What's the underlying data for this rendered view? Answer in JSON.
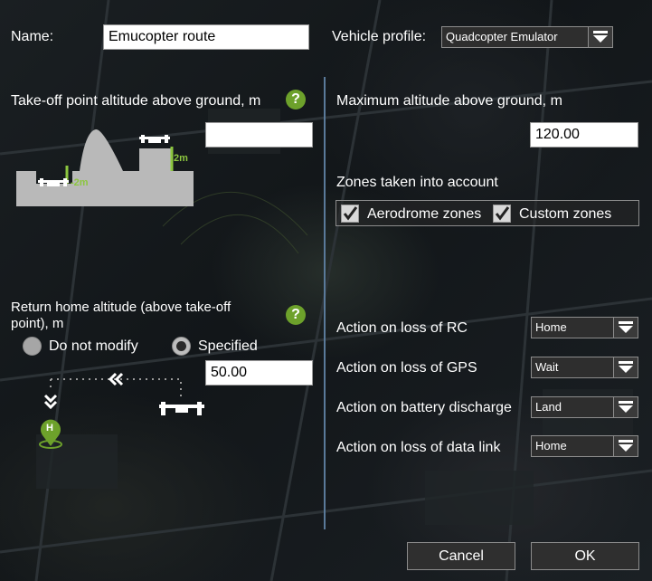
{
  "header": {
    "name_label": "Name:",
    "name_value": "Emucopter route",
    "vehicle_profile_label": "Vehicle profile:",
    "vehicle_profile_value": "Quadcopter Emulator"
  },
  "left": {
    "takeoff_label": "Take-off point altitude above ground, m",
    "takeoff_value": "",
    "takeoff_help": "?",
    "diagram_labels": {
      "right_height": "2m",
      "left_height": "-2m"
    },
    "return_label_line1": "Return home altitude (above take-off",
    "return_label_line2": "point), m",
    "return_help": "?",
    "radio_do_not_modify": "Do not modify",
    "radio_specified": "Specified",
    "return_value": "50.00",
    "home_marker_letter": "H"
  },
  "right": {
    "max_alt_label": "Maximum altitude above ground, m",
    "max_alt_value": "120.00",
    "zones_label": "Zones taken into account",
    "zone_aerodrome": "Aerodrome zones",
    "zone_custom": "Custom zones",
    "failsafe": [
      {
        "label": "Action on loss of RC",
        "value": "Home"
      },
      {
        "label": "Action on loss of GPS",
        "value": "Wait"
      },
      {
        "label": "Action on battery discharge",
        "value": "Land"
      },
      {
        "label": "Action on loss of data link",
        "value": "Home"
      }
    ]
  },
  "footer": {
    "cancel_label": "Cancel",
    "ok_label": "OK"
  },
  "colors": {
    "accent_green": "#6da12b",
    "divider": "#5a7a9a"
  }
}
